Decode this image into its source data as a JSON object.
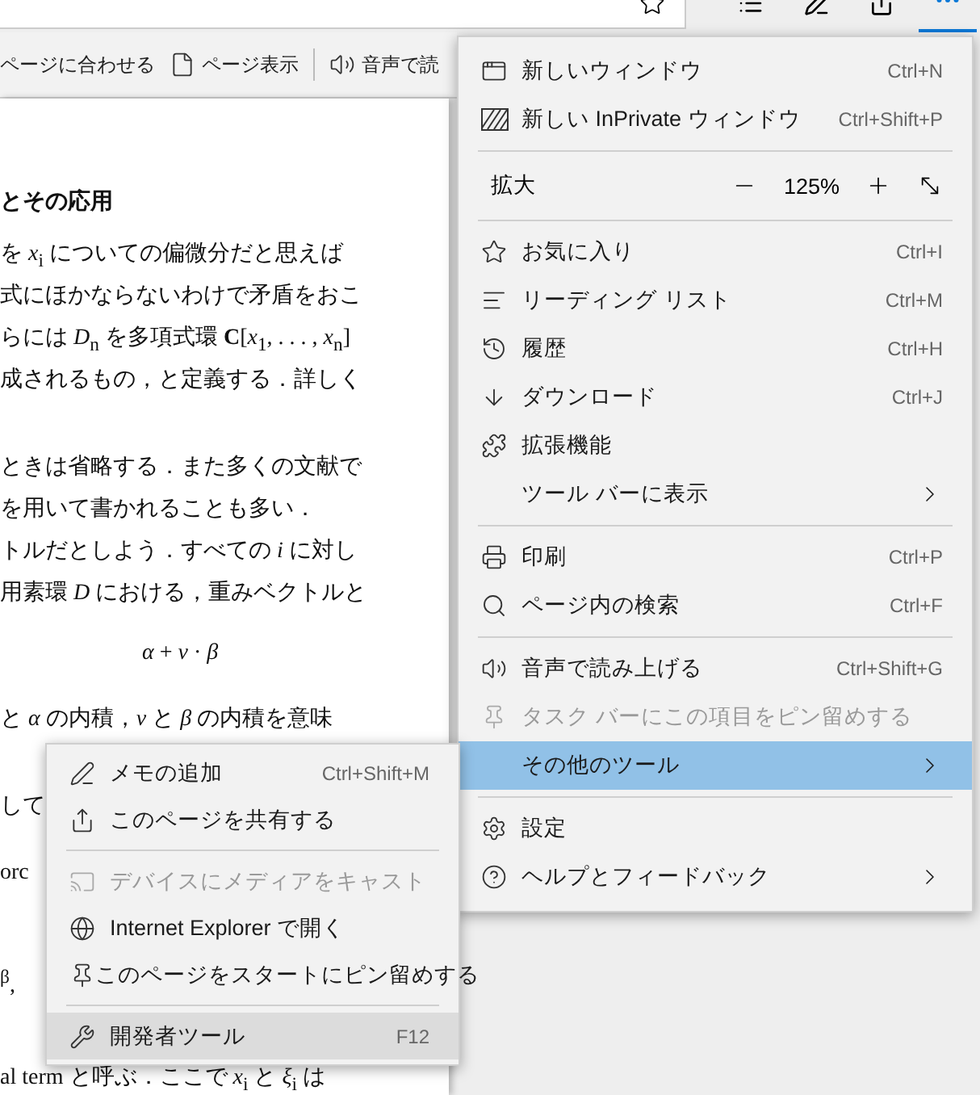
{
  "toolbar": {
    "items": [
      "ページに合わせる",
      "ページ表示",
      "音声で読"
    ]
  },
  "document": {
    "lines": [
      {
        "kind": "heading",
        "text": "とその応用"
      },
      {
        "kind": "line",
        "text": "を *x*$_{i}$ についての偏微分だと思えば"
      },
      {
        "kind": "line",
        "text": "式にほかならないわけで矛盾をおこ"
      },
      {
        "kind": "line",
        "text": "らには *D*$_{n}$ を多項式環 **C**[*x*$_{1}$, . . . , *x*$_{n}$]"
      },
      {
        "kind": "line",
        "text": "成されるもの，と定義する．詳しく"
      },
      {
        "kind": "para",
        "text": "ときは省略する．また多くの文献で"
      },
      {
        "kind": "line",
        "text": "を用いて書かれることも多い．"
      },
      {
        "kind": "line",
        "text": "トルだとしよう．すべての *i* に対し"
      },
      {
        "kind": "line",
        "text": "用素環 *D* における，重みベクトルと"
      },
      {
        "kind": "formula",
        "text": "*α* + *v* · *β*"
      },
      {
        "kind": "gap",
        "text": "と *α* の内積，*v* と *β* の内積を意味"
      },
      {
        "kind": "para",
        "text": "して"
      },
      {
        "kind": "gap",
        "text": "orc"
      },
      {
        "kind": "wide",
        "text": "$^{β}$,"
      },
      {
        "kind": "last",
        "text": "al term と呼ぶ．ここで *x*$_{i}$ と *ξ*$_{i}$ は"
      }
    ]
  },
  "menu": {
    "items": [
      {
        "kind": "item",
        "label": "新しいウィンドウ",
        "shortcut": "Ctrl+N",
        "submenu": false,
        "disabled": false,
        "selected": false
      },
      {
        "kind": "item",
        "label": "新しい InPrivate ウィンドウ",
        "shortcut": "Ctrl+Shift+P",
        "submenu": false,
        "disabled": false,
        "selected": false
      },
      {
        "kind": "separator"
      },
      {
        "kind": "zoom",
        "label": "拡大",
        "value": "125%"
      },
      {
        "kind": "separator"
      },
      {
        "kind": "item",
        "label": "お気に入り",
        "shortcut": "Ctrl+I",
        "submenu": false,
        "disabled": false,
        "selected": false
      },
      {
        "kind": "item",
        "label": "リーディング リスト",
        "shortcut": "Ctrl+M",
        "submenu": false,
        "disabled": false,
        "selected": false
      },
      {
        "kind": "item",
        "label": "履歴",
        "shortcut": "Ctrl+H",
        "submenu": false,
        "disabled": false,
        "selected": false
      },
      {
        "kind": "item",
        "label": "ダウンロード",
        "shortcut": "Ctrl+J",
        "submenu": false,
        "disabled": false,
        "selected": false
      },
      {
        "kind": "item",
        "label": "拡張機能",
        "submenu": false,
        "disabled": false,
        "selected": false
      },
      {
        "kind": "item",
        "label": "ツール バーに表示",
        "submenu": true,
        "disabled": false,
        "selected": false
      },
      {
        "kind": "separator"
      },
      {
        "kind": "item",
        "label": "印刷",
        "shortcut": "Ctrl+P",
        "submenu": false,
        "disabled": false,
        "selected": false
      },
      {
        "kind": "item",
        "label": "ページ内の検索",
        "shortcut": "Ctrl+F",
        "submenu": false,
        "disabled": false,
        "selected": false
      },
      {
        "kind": "separator"
      },
      {
        "kind": "item",
        "label": "音声で読み上げる",
        "shortcut": "Ctrl+Shift+G",
        "submenu": false,
        "disabled": false,
        "selected": false
      },
      {
        "kind": "item",
        "label": "タスク バーにこの項目をピン留めする",
        "submenu": false,
        "disabled": true,
        "selected": false
      },
      {
        "kind": "item",
        "label": "その他のツール",
        "submenu": true,
        "disabled": false,
        "selected": true
      },
      {
        "kind": "separator"
      },
      {
        "kind": "item",
        "label": "設定",
        "submenu": false,
        "disabled": false,
        "selected": false
      },
      {
        "kind": "item",
        "label": "ヘルプとフィードバック",
        "submenu": true,
        "disabled": false,
        "selected": false
      }
    ]
  },
  "submenu": {
    "items": [
      {
        "kind": "item",
        "label": "メモの追加",
        "shortcut": "Ctrl+Shift+M",
        "disabled": false,
        "selected": false
      },
      {
        "kind": "item",
        "label": "このページを共有する",
        "disabled": false,
        "selected": false
      },
      {
        "kind": "separator"
      },
      {
        "kind": "item",
        "label": "デバイスにメディアをキャスト",
        "disabled": true,
        "selected": false
      },
      {
        "kind": "item",
        "label": "Internet Explorer で開く",
        "disabled": false,
        "selected": false
      },
      {
        "kind": "item",
        "label": "このページをスタートにピン留めする",
        "disabled": false,
        "selected": false
      },
      {
        "kind": "separator"
      },
      {
        "kind": "item",
        "label": "開発者ツール",
        "shortcut": "F12",
        "disabled": false,
        "selected": true
      }
    ]
  }
}
